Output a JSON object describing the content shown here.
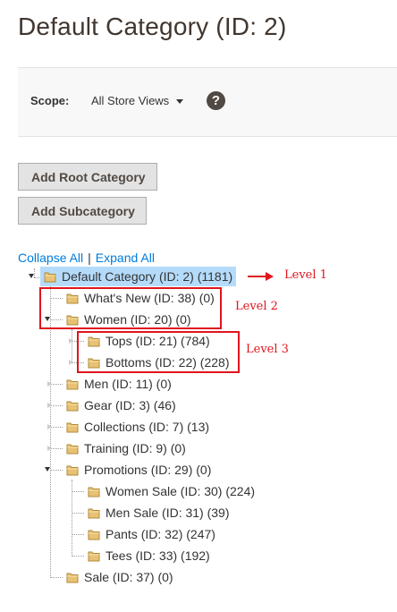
{
  "header": {
    "title": "Default Category (ID: 2)"
  },
  "scope": {
    "label": "Scope:",
    "selected": "All Store Views",
    "help_symbol": "?"
  },
  "buttons": {
    "add_root": "Add Root Category",
    "add_sub": "Add Subcategory"
  },
  "tree_links": {
    "collapse": "Collapse All",
    "separator": "|",
    "expand": "Expand All"
  },
  "tree": {
    "root": "Default Category (ID: 2) (1181)",
    "whats_new": "What's New (ID: 38) (0)",
    "women": "Women (ID: 20) (0)",
    "tops": "Tops (ID: 21) (784)",
    "bottoms": "Bottoms (ID: 22) (228)",
    "men": "Men (ID: 11) (0)",
    "gear": "Gear (ID: 3) (46)",
    "collections": "Collections (ID: 7) (13)",
    "training": "Training (ID: 9) (0)",
    "promotions": "Promotions (ID: 29) (0)",
    "women_sale": "Women Sale (ID: 30) (224)",
    "men_sale": "Men Sale (ID: 31) (39)",
    "pants": "Pants (ID: 32) (247)",
    "tees": "Tees (ID: 33) (192)",
    "sale": "Sale (ID: 37) (0)"
  },
  "annotations": {
    "level1": "Level 1",
    "level2": "Level 2",
    "level3": "Level 3"
  },
  "colors": {
    "selected_bg": "#b5dbfb",
    "link": "#007bdb",
    "annotation": "#e0141e",
    "folder": "#e8c274"
  },
  "icons": {
    "folder": "folder-icon",
    "help": "help-icon",
    "dropdown": "caret-down-icon"
  }
}
